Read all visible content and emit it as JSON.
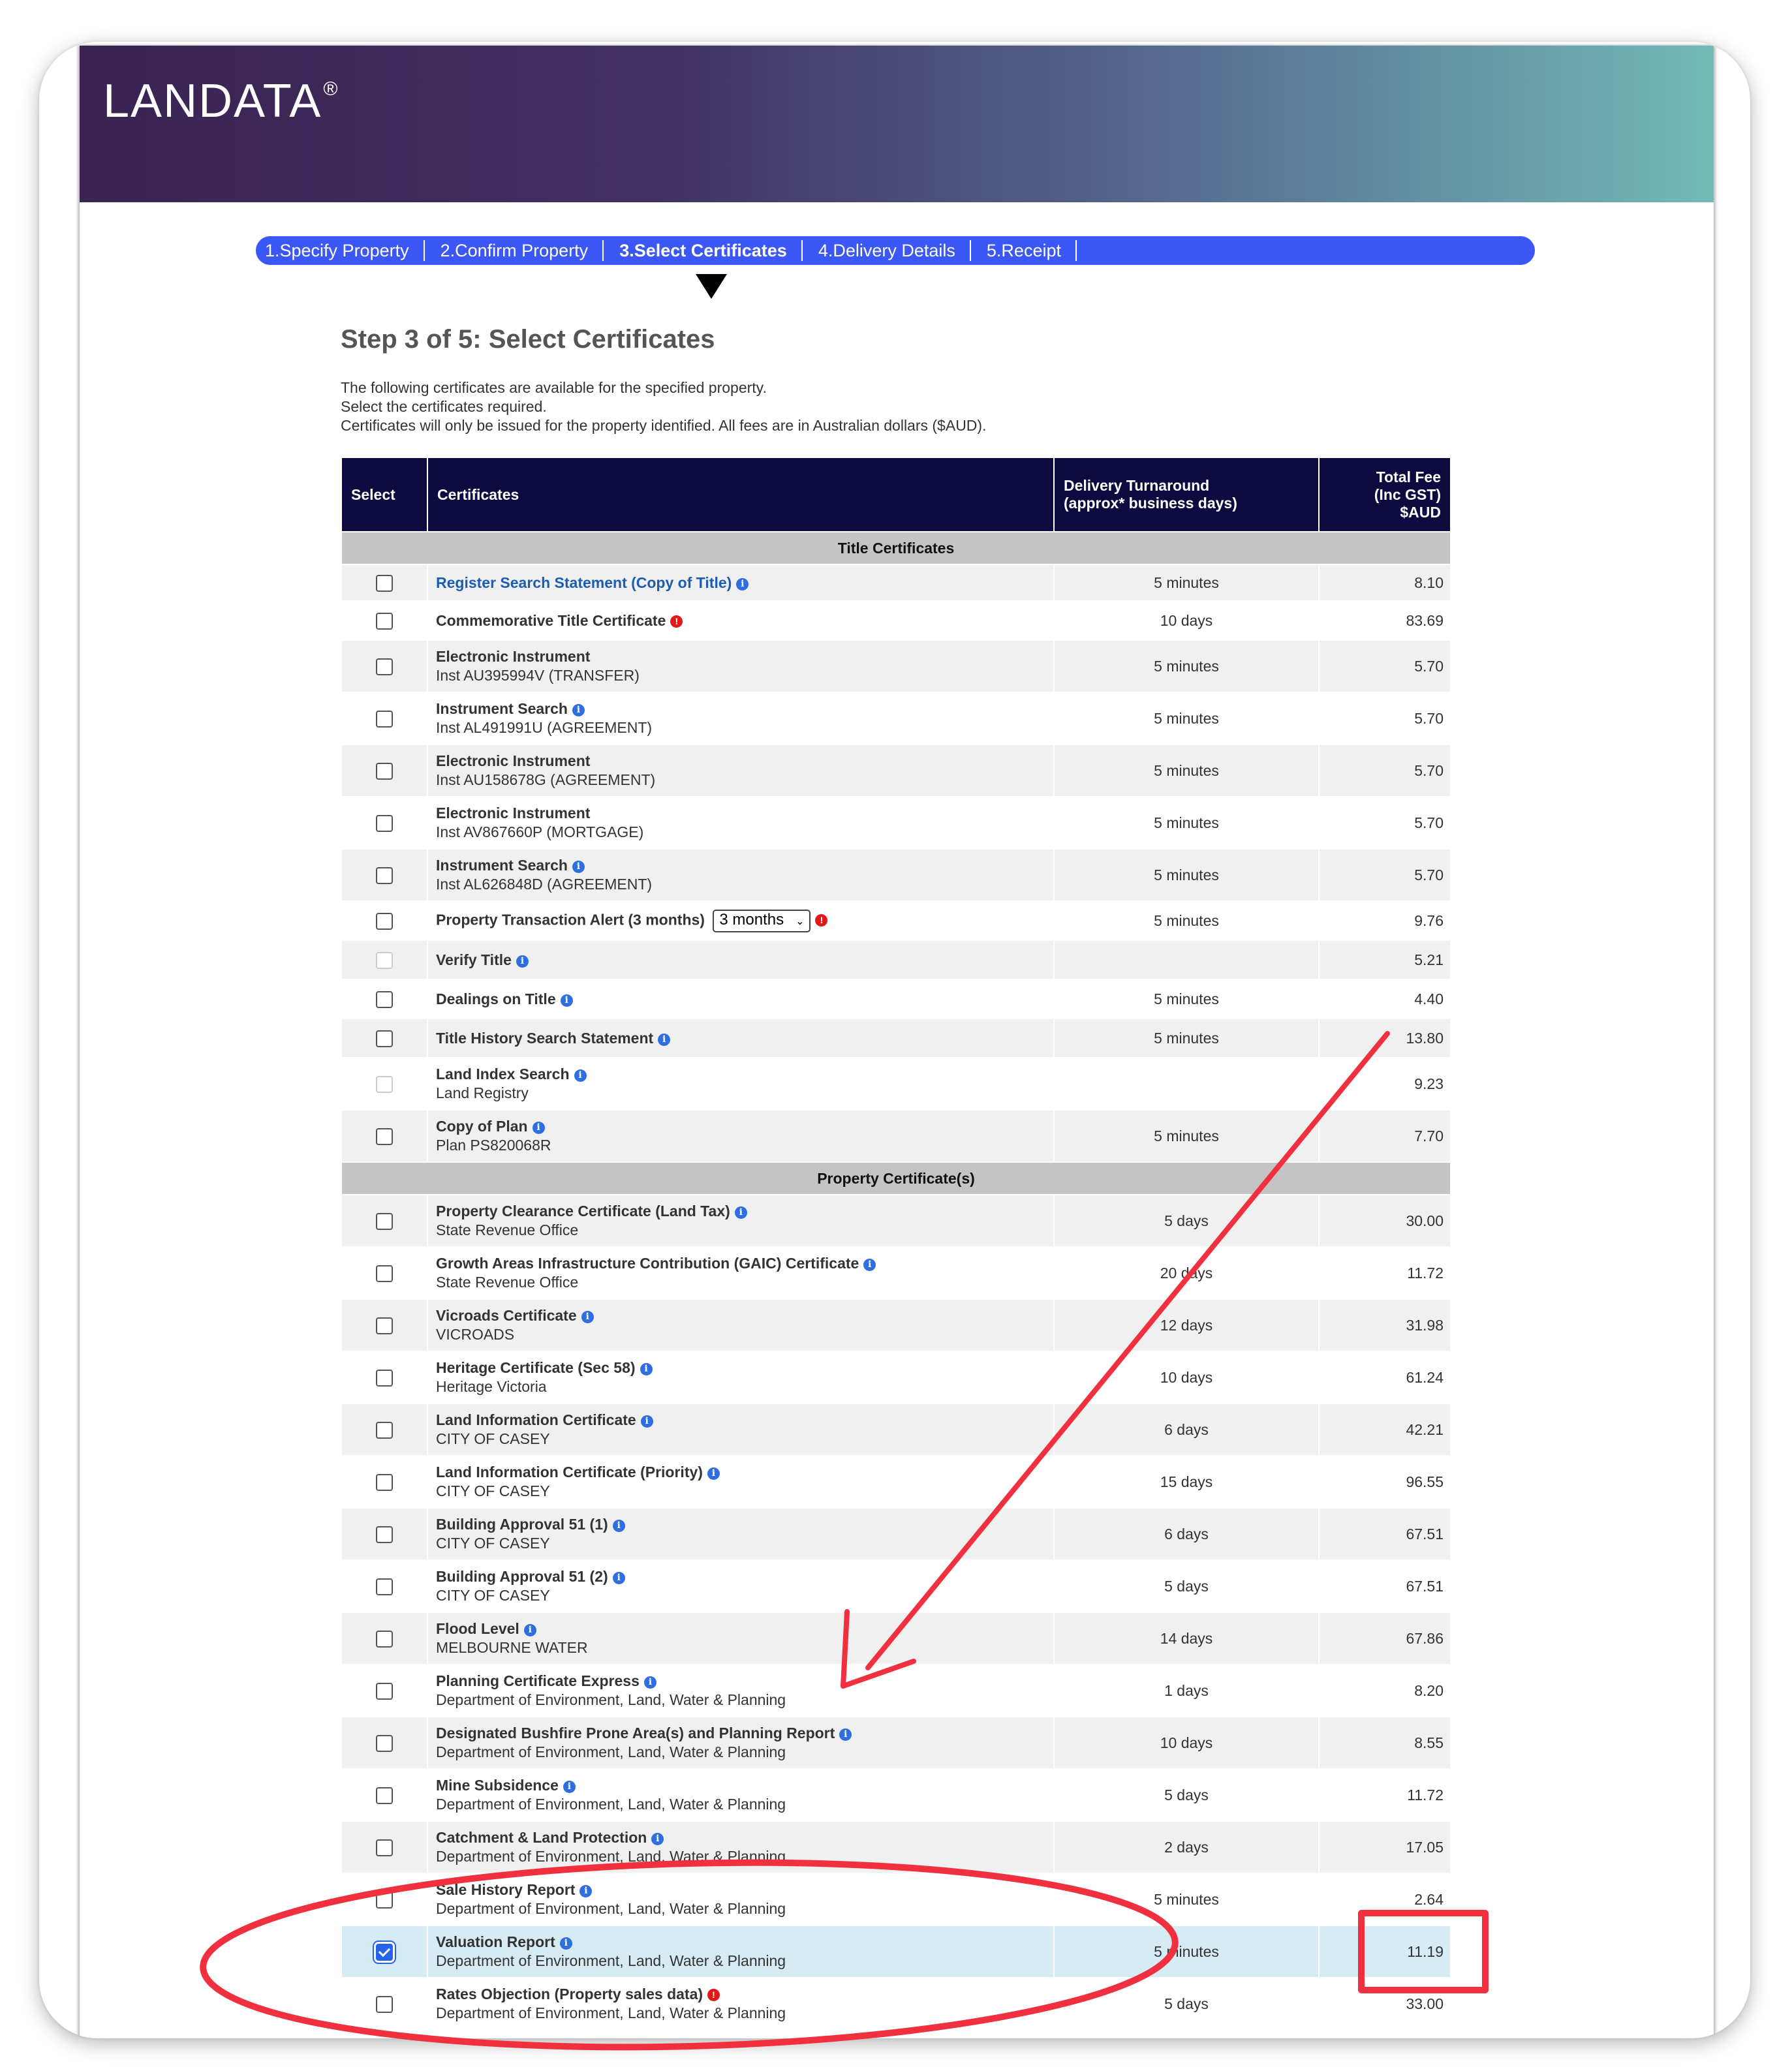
{
  "brand": {
    "logo_text": "LANDATA",
    "logo_mark": "®"
  },
  "steps": [
    {
      "label": "1.Specify Property"
    },
    {
      "label": "2.Confirm Property"
    },
    {
      "label": "3.Select Certificates"
    },
    {
      "label": "4.Delivery Details"
    },
    {
      "label": "5.Receipt"
    }
  ],
  "heading": "Step 3 of 5: Select Certificates",
  "intro": [
    "The following certificates are available for the specified property.",
    "Select the certificates required.",
    "Certificates will only be issued for the property identified.  All fees are in Australian dollars ($AUD)."
  ],
  "table_header": {
    "select": "Select",
    "certificates": "Certificates",
    "delivery_1": "Delivery Turnaround",
    "delivery_2": "(approx* business days)",
    "fee_1": "Total Fee",
    "fee_2": "(Inc GST)",
    "fee_3": "$AUD"
  },
  "sections": {
    "title": "Title Certificates",
    "property": "Property Certificate(s)"
  },
  "title_rows": [
    {
      "name": "Register Search Statement (Copy of Title)",
      "sub": "",
      "delivery": "5 minutes",
      "fee": "8.10"
    },
    {
      "name": "Commemorative Title Certificate",
      "sub": "",
      "delivery": "10 days",
      "fee": "83.69"
    },
    {
      "name": "Electronic Instrument",
      "sub": "Inst AU395994V (TRANSFER)",
      "delivery": "5 minutes",
      "fee": "5.70"
    },
    {
      "name": "Instrument Search",
      "sub": "Inst AL491991U (AGREEMENT)",
      "delivery": "5 minutes",
      "fee": "5.70"
    },
    {
      "name": "Electronic Instrument",
      "sub": "Inst AU158678G (AGREEMENT)",
      "delivery": "5 minutes",
      "fee": "5.70"
    },
    {
      "name": "Electronic Instrument",
      "sub": "Inst AV867660P (MORTGAGE)",
      "delivery": "5 minutes",
      "fee": "5.70"
    },
    {
      "name": "Instrument Search",
      "sub": "Inst AL626848D (AGREEMENT)",
      "delivery": "5 minutes",
      "fee": "5.70"
    },
    {
      "name": "Property Transaction Alert (3 months)",
      "sub": "",
      "select_value": "3 months",
      "delivery": "5 minutes",
      "fee": "9.76"
    },
    {
      "name": "Verify Title",
      "sub": "",
      "delivery": "",
      "fee": "5.21"
    },
    {
      "name": "Dealings on Title",
      "sub": "",
      "delivery": "5 minutes",
      "fee": "4.40"
    },
    {
      "name": "Title History Search Statement",
      "sub": "",
      "delivery": "5 minutes",
      "fee": "13.80"
    },
    {
      "name": "Land Index Search",
      "sub": "Land Registry",
      "delivery": "",
      "fee": "9.23"
    },
    {
      "name": "Copy of Plan",
      "sub": "Plan PS820068R",
      "delivery": "5 minutes",
      "fee": "7.70"
    }
  ],
  "property_rows": [
    {
      "name": "Property Clearance Certificate (Land Tax)",
      "sub": "State Revenue Office",
      "delivery": "5 days",
      "fee": "30.00"
    },
    {
      "name": "Growth Areas Infrastructure Contribution (GAIC) Certificate",
      "sub": "State Revenue Office",
      "delivery": "20 days",
      "fee": "11.72"
    },
    {
      "name": "Vicroads Certificate",
      "sub": "VICROADS",
      "delivery": "12 days",
      "fee": "31.98"
    },
    {
      "name": "Heritage Certificate (Sec 58)",
      "sub": "Heritage Victoria",
      "delivery": "10 days",
      "fee": "61.24"
    },
    {
      "name": "Land Information Certificate",
      "sub": "CITY OF CASEY",
      "delivery": "6 days",
      "fee": "42.21"
    },
    {
      "name": "Land Information Certificate (Priority)",
      "sub": "CITY OF CASEY",
      "delivery": "15 days",
      "fee": "96.55"
    },
    {
      "name": "Building Approval 51 (1)",
      "sub": "CITY OF CASEY",
      "delivery": "6 days",
      "fee": "67.51"
    },
    {
      "name": "Building Approval 51 (2)",
      "sub": "CITY OF CASEY",
      "delivery": "5 days",
      "fee": "67.51"
    },
    {
      "name": "Flood Level",
      "sub": "MELBOURNE WATER",
      "delivery": "14 days",
      "fee": "67.86"
    },
    {
      "name": "Planning Certificate Express",
      "sub": "Department of Environment, Land, Water & Planning",
      "delivery": "1 days",
      "fee": "8.20"
    },
    {
      "name": "Designated Bushfire Prone Area(s) and Planning Report",
      "sub": "Department of Environment, Land, Water & Planning",
      "delivery": "10 days",
      "fee": "8.55"
    },
    {
      "name": "Mine Subsidence",
      "sub": "Department of Environment, Land, Water & Planning",
      "delivery": "5 days",
      "fee": "11.72"
    },
    {
      "name": "Catchment & Land Protection",
      "sub": "Department of Environment, Land, Water & Planning",
      "delivery": "2 days",
      "fee": "17.05"
    },
    {
      "name": "Sale History Report",
      "sub": "Department of Environment, Land, Water & Planning",
      "delivery": "5 minutes",
      "fee": "2.64"
    },
    {
      "name": "Valuation Report",
      "sub": "Department of Environment, Land, Water & Planning",
      "delivery": "5 minutes",
      "fee": "11.19"
    },
    {
      "name": "Rates Objection (Property sales data)",
      "sub": "Department of Environment, Land, Water & Planning",
      "delivery": "5 days",
      "fee": "33.00"
    }
  ],
  "colors": {
    "annotation": "#f0303f",
    "step_bar": "#3b57f5",
    "header": "#0c0a3e",
    "info_icon": "#2e6ee0",
    "alert_icon": "#e01818"
  }
}
